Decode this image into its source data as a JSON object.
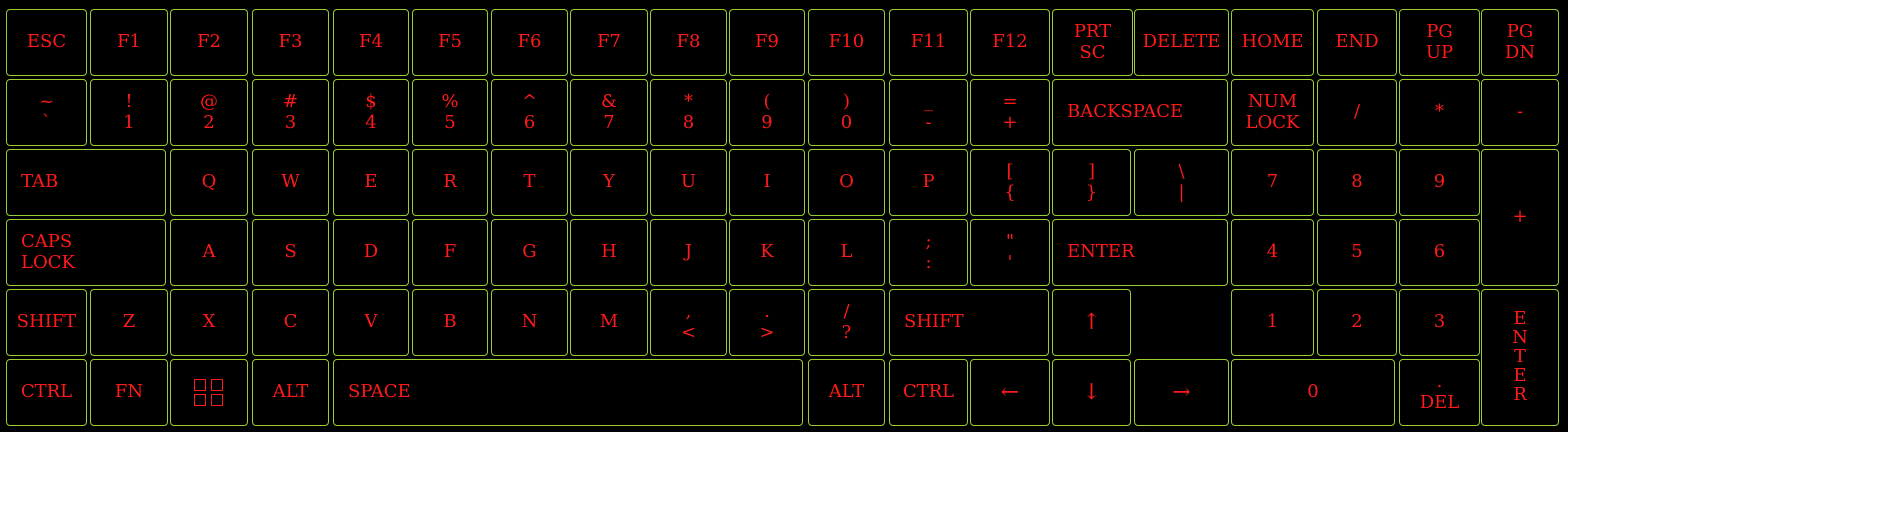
{
  "keyboard": {
    "row1": [
      {
        "id": "esc",
        "lines": [
          "ESC"
        ]
      },
      {
        "id": "f1",
        "lines": [
          "F1"
        ]
      },
      {
        "id": "f2",
        "lines": [
          "F2"
        ]
      },
      {
        "id": "f3",
        "lines": [
          "F3"
        ]
      },
      {
        "id": "f4",
        "lines": [
          "F4"
        ]
      },
      {
        "id": "f5",
        "lines": [
          "F5"
        ]
      },
      {
        "id": "f6",
        "lines": [
          "F6"
        ]
      },
      {
        "id": "f7",
        "lines": [
          "F7"
        ]
      },
      {
        "id": "f8",
        "lines": [
          "F8"
        ]
      },
      {
        "id": "f9",
        "lines": [
          "F9"
        ]
      },
      {
        "id": "f10",
        "lines": [
          "F10"
        ]
      },
      {
        "id": "f11",
        "lines": [
          "F11"
        ]
      },
      {
        "id": "f12",
        "lines": [
          "F12"
        ]
      },
      {
        "id": "prtsc",
        "lines": [
          "PRT",
          "SC"
        ]
      },
      {
        "id": "delete",
        "lines": [
          "DELETE"
        ]
      },
      {
        "id": "home",
        "lines": [
          "HOME"
        ]
      },
      {
        "id": "end",
        "lines": [
          "END"
        ]
      },
      {
        "id": "pgup",
        "lines": [
          "PG",
          "UP"
        ]
      },
      {
        "id": "pgdn",
        "lines": [
          "PG",
          "DN"
        ]
      }
    ],
    "row2": [
      {
        "id": "tilde",
        "lines": [
          "~",
          "`"
        ]
      },
      {
        "id": "1",
        "lines": [
          "!",
          "1"
        ]
      },
      {
        "id": "2",
        "lines": [
          "@",
          "2"
        ]
      },
      {
        "id": "3",
        "lines": [
          "#",
          "3"
        ]
      },
      {
        "id": "4",
        "lines": [
          "$",
          "4"
        ]
      },
      {
        "id": "5",
        "lines": [
          "%",
          "5"
        ]
      },
      {
        "id": "6",
        "lines": [
          "^",
          "6"
        ]
      },
      {
        "id": "7",
        "lines": [
          "&",
          "7"
        ]
      },
      {
        "id": "8",
        "lines": [
          "*",
          "8"
        ]
      },
      {
        "id": "9",
        "lines": [
          "(",
          "9"
        ]
      },
      {
        "id": "0",
        "lines": [
          ")",
          "0"
        ]
      },
      {
        "id": "minus",
        "lines": [
          "_",
          "-"
        ]
      },
      {
        "id": "equals",
        "lines": [
          "=",
          "+"
        ]
      },
      {
        "id": "backspace",
        "lines": [
          "BACKSPACE"
        ]
      },
      {
        "id": "numlock",
        "lines": [
          "NUM",
          "LOCK"
        ]
      },
      {
        "id": "np-slash",
        "lines": [
          "/"
        ]
      },
      {
        "id": "np-star",
        "lines": [
          "*"
        ]
      },
      {
        "id": "np-minus",
        "lines": [
          "-"
        ]
      }
    ],
    "row3": [
      {
        "id": "tab",
        "lines": [
          "TAB"
        ]
      },
      {
        "id": "q",
        "lines": [
          "Q"
        ]
      },
      {
        "id": "w",
        "lines": [
          "W"
        ]
      },
      {
        "id": "e",
        "lines": [
          "E"
        ]
      },
      {
        "id": "r",
        "lines": [
          "R"
        ]
      },
      {
        "id": "t",
        "lines": [
          "T"
        ]
      },
      {
        "id": "y",
        "lines": [
          "Y"
        ]
      },
      {
        "id": "u",
        "lines": [
          "U"
        ]
      },
      {
        "id": "i",
        "lines": [
          "I"
        ]
      },
      {
        "id": "o",
        "lines": [
          "O"
        ]
      },
      {
        "id": "p",
        "lines": [
          "P"
        ]
      },
      {
        "id": "lbracket",
        "lines": [
          "[",
          "{"
        ]
      },
      {
        "id": "rbracket",
        "lines": [
          "]",
          "}"
        ]
      },
      {
        "id": "backslash",
        "lines": [
          "\\",
          "|"
        ]
      },
      {
        "id": "np-7",
        "lines": [
          "7"
        ]
      },
      {
        "id": "np-8",
        "lines": [
          "8"
        ]
      },
      {
        "id": "np-9",
        "lines": [
          "9"
        ]
      },
      {
        "id": "np-plus",
        "lines": [
          "+"
        ]
      }
    ],
    "row4": [
      {
        "id": "capslock",
        "lines": [
          "CAPS",
          "LOCK"
        ]
      },
      {
        "id": "a",
        "lines": [
          "A"
        ]
      },
      {
        "id": "s",
        "lines": [
          "S"
        ]
      },
      {
        "id": "d",
        "lines": [
          "D"
        ]
      },
      {
        "id": "f",
        "lines": [
          "F"
        ]
      },
      {
        "id": "g",
        "lines": [
          "G"
        ]
      },
      {
        "id": "h",
        "lines": [
          "H"
        ]
      },
      {
        "id": "j",
        "lines": [
          "J"
        ]
      },
      {
        "id": "k",
        "lines": [
          "K"
        ]
      },
      {
        "id": "l",
        "lines": [
          "L"
        ]
      },
      {
        "id": "semicolon",
        "lines": [
          ";",
          ":"
        ]
      },
      {
        "id": "quote",
        "lines": [
          "\"",
          "'"
        ]
      },
      {
        "id": "enter",
        "lines": [
          "ENTER"
        ]
      },
      {
        "id": "np-4",
        "lines": [
          "4"
        ]
      },
      {
        "id": "np-5",
        "lines": [
          "5"
        ]
      },
      {
        "id": "np-6",
        "lines": [
          "6"
        ]
      }
    ],
    "row5": [
      {
        "id": "lshift",
        "lines": [
          "SHIFT"
        ]
      },
      {
        "id": "z",
        "lines": [
          "Z"
        ]
      },
      {
        "id": "x",
        "lines": [
          "X"
        ]
      },
      {
        "id": "c",
        "lines": [
          "C"
        ]
      },
      {
        "id": "v",
        "lines": [
          "V"
        ]
      },
      {
        "id": "b",
        "lines": [
          "B"
        ]
      },
      {
        "id": "n",
        "lines": [
          "N"
        ]
      },
      {
        "id": "m",
        "lines": [
          "M"
        ]
      },
      {
        "id": "comma",
        "lines": [
          ",",
          "<"
        ]
      },
      {
        "id": "period",
        "lines": [
          ".",
          ">"
        ]
      },
      {
        "id": "slash",
        "lines": [
          "/",
          "?"
        ]
      },
      {
        "id": "rshift",
        "lines": [
          "SHIFT"
        ]
      },
      {
        "id": "up",
        "lines": [
          "↑"
        ]
      },
      {
        "id": "np-1",
        "lines": [
          "1"
        ]
      },
      {
        "id": "np-2",
        "lines": [
          "2"
        ]
      },
      {
        "id": "np-3",
        "lines": [
          "3"
        ]
      },
      {
        "id": "np-enter",
        "lines": [
          "E",
          "N",
          "T",
          "E",
          "R"
        ]
      }
    ],
    "row6": [
      {
        "id": "lctrl",
        "lines": [
          "CTRL"
        ]
      },
      {
        "id": "fn",
        "lines": [
          "FN"
        ]
      },
      {
        "id": "win",
        "lines": [],
        "icon": "windows-icon"
      },
      {
        "id": "lalt",
        "lines": [
          "ALT"
        ]
      },
      {
        "id": "space",
        "lines": [
          "SPACE"
        ]
      },
      {
        "id": "ralt",
        "lines": [
          "ALT"
        ]
      },
      {
        "id": "rctrl",
        "lines": [
          "CTRL"
        ]
      },
      {
        "id": "left",
        "lines": [
          "←"
        ]
      },
      {
        "id": "down",
        "lines": [
          "↓"
        ]
      },
      {
        "id": "right",
        "lines": [
          "→"
        ]
      },
      {
        "id": "np-0",
        "lines": [
          "0"
        ]
      },
      {
        "id": "np-del",
        "lines": [
          ".",
          "DEL"
        ]
      }
    ]
  },
  "colors": {
    "key_text": "#ff1a1a",
    "key_border": "#9ACD32",
    "key_bg": "#000000"
  }
}
